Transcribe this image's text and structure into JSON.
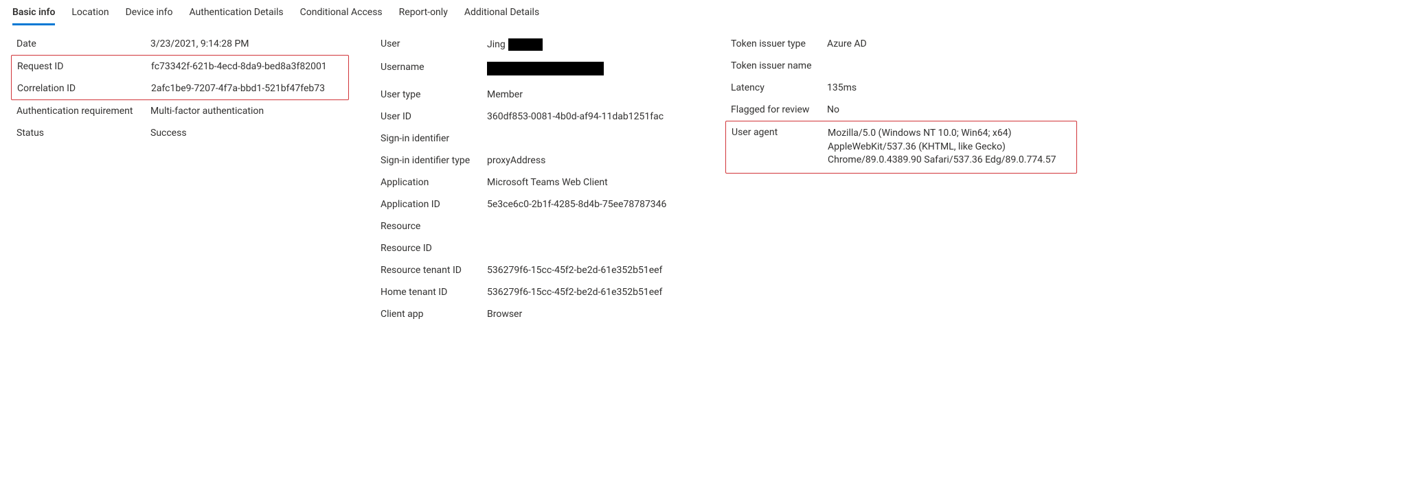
{
  "tabs": {
    "basic_info": "Basic info",
    "location": "Location",
    "device_info": "Device info",
    "auth_details": "Authentication Details",
    "conditional_access": "Conditional Access",
    "report_only": "Report-only",
    "additional_details": "Additional Details"
  },
  "col1": {
    "date_label": "Date",
    "date_value": "3/23/2021, 9:14:28 PM",
    "request_id_label": "Request ID",
    "request_id_value": "fc73342f-621b-4ecd-8da9-bed8a3f82001",
    "correlation_id_label": "Correlation ID",
    "correlation_id_value": "2afc1be9-7207-4f7a-bbd1-521bf47feb73",
    "auth_req_label": "Authentication requirement",
    "auth_req_value": "Multi-factor authentication",
    "status_label": "Status",
    "status_value": "Success"
  },
  "col2": {
    "user_label": "User",
    "user_value": "Jing",
    "username_label": "Username",
    "username_value": "",
    "user_type_label": "User type",
    "user_type_value": "Member",
    "user_id_label": "User ID",
    "user_id_value": "360df853-0081-4b0d-af94-11dab1251fac",
    "signin_id_label": "Sign-in identifier",
    "signin_id_value": "",
    "signin_id_type_label": "Sign-in identifier type",
    "signin_id_type_value": "proxyAddress",
    "application_label": "Application",
    "application_value": "Microsoft Teams Web Client",
    "application_id_label": "Application ID",
    "application_id_value": "5e3ce6c0-2b1f-4285-8d4b-75ee78787346",
    "resource_label": "Resource",
    "resource_value": "",
    "resource_id_label": "Resource ID",
    "resource_id_value": "",
    "resource_tenant_id_label": "Resource tenant ID",
    "resource_tenant_id_value": "536279f6-15cc-45f2-be2d-61e352b51eef",
    "home_tenant_id_label": "Home tenant ID",
    "home_tenant_id_value": "536279f6-15cc-45f2-be2d-61e352b51eef",
    "client_app_label": "Client app",
    "client_app_value": "Browser"
  },
  "col3": {
    "token_issuer_type_label": "Token issuer type",
    "token_issuer_type_value": "Azure AD",
    "token_issuer_name_label": "Token issuer name",
    "token_issuer_name_value": "",
    "latency_label": "Latency",
    "latency_value": "135ms",
    "flagged_label": "Flagged for review",
    "flagged_value": "No",
    "user_agent_label": "User agent",
    "user_agent_value": "Mozilla/5.0 (Windows NT 10.0; Win64; x64) AppleWebKit/537.36 (KHTML, like Gecko) Chrome/89.0.4389.90 Safari/537.36 Edg/89.0.774.57"
  }
}
